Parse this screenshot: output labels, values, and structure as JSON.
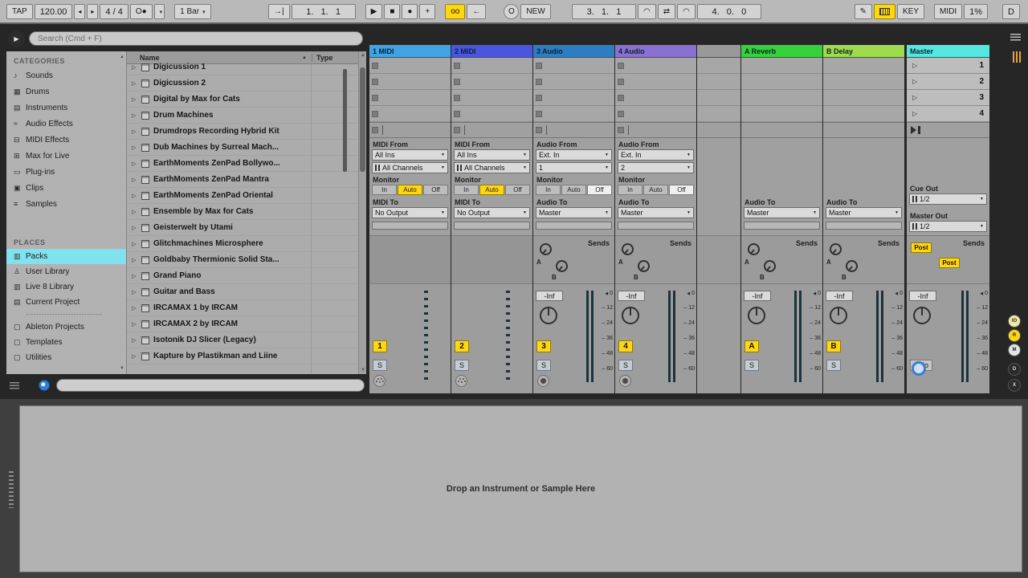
{
  "transport": {
    "tap": "TAP",
    "tempo": "120.00",
    "time_sig": "4 / 4",
    "quantize": "1 Bar",
    "position": "1.   1.   1",
    "new": "NEW",
    "loop_start": "3.   1.   1",
    "loop_length": "4.   0.   0",
    "key": "KEY",
    "midi": "MIDI",
    "cpu": "1%",
    "disk": "D"
  },
  "icons": {
    "preview_play": "▶",
    "nudge_down": "◂",
    "nudge_up": "▸",
    "metronome": "O●",
    "follow": "→|",
    "play": "▶",
    "stop": "■",
    "record": "●",
    "overdub": "+",
    "automation_arm": "oo",
    "reenable_automation": "←",
    "session_record": "O",
    "punch_in": "◠",
    "loop": "⇄",
    "punch_out": "◠",
    "draw": "✎",
    "expander": "▷",
    "sort_asc": "▲",
    "scroll_up": "▲",
    "scroll_down": "▼",
    "scene_play": "▷",
    "clip_zero": "◀"
  },
  "colors": {
    "track1": "#41a3e3",
    "track2": "#4b55dd",
    "track3": "#2e7cc1",
    "track4": "#8a70d0",
    "returnA": "#35d23c",
    "returnB": "#9edc4d",
    "master": "#55e6e0",
    "accent_yellow": "#ffd613",
    "selected_cyan": "#7fe2ee"
  },
  "browser": {
    "search_placeholder": "Search (Cmd + F)",
    "categories_title": "CATEGORIES",
    "categories": [
      {
        "icon": "♪",
        "label": "Sounds"
      },
      {
        "icon": "▦",
        "label": "Drums"
      },
      {
        "icon": "▤",
        "label": "Instruments"
      },
      {
        "icon": "≈",
        "label": "Audio Effects"
      },
      {
        "icon": "⊟",
        "label": "MIDI Effects"
      },
      {
        "icon": "⊞",
        "label": "Max for Live"
      },
      {
        "icon": "▭",
        "label": "Plug-ins"
      },
      {
        "icon": "▣",
        "label": "Clips"
      },
      {
        "icon": "≡",
        "label": "Samples"
      }
    ],
    "places_title": "PLACES",
    "places": [
      {
        "icon": "▥",
        "label": "Packs"
      },
      {
        "icon": "♙",
        "label": "User Library"
      },
      {
        "icon": "▥",
        "label": "Live 8 Library"
      },
      {
        "icon": "▤",
        "label": "Current Project"
      },
      {
        "icon": "",
        "label": "-----------------------------"
      },
      {
        "icon": "▢",
        "label": "Ableton Projects"
      },
      {
        "icon": "▢",
        "label": "Templates"
      },
      {
        "icon": "▢",
        "label": "Utilities"
      }
    ],
    "name_header": "Name",
    "type_header": "Type",
    "items": [
      "Digicussion 1",
      "Digicussion 2",
      "Digital by Max for Cats",
      "Drum Machines",
      "Drumdrops Recording Hybrid Kit",
      "Dub Machines by Surreal Mach...",
      "EarthMoments ZenPad Bollywo...",
      "EarthMoments ZenPad Mantra",
      "EarthMoments ZenPad Oriental",
      "Ensemble by Max for Cats",
      "Geisterwelt by Utami",
      "Glitchmachines Microsphere",
      "Goldbaby Thermionic Solid Sta...",
      "Grand Piano",
      "Guitar and Bass",
      "IRCAMAX 1 by IRCAM",
      "IRCAMAX 2 by IRCAM",
      "Isotonik DJ Slicer (Legacy)",
      "Kapture by Plastikman and Liine"
    ]
  },
  "session": {
    "scenes": [
      "1",
      "2",
      "3",
      "4"
    ],
    "zero": "0",
    "meter_scale": [
      "12",
      "24",
      "36",
      "48",
      "60"
    ],
    "sends_label": "Sends",
    "send_a": "A",
    "send_b": "B",
    "toggles": [
      {
        "label": "IO",
        "bg": "#efe9a8"
      },
      {
        "label": "R",
        "bg": "#ffd613"
      },
      {
        "label": "M",
        "bg": "#e4e4e4"
      },
      {
        "label": "D",
        "bg": "#2b2b2b"
      },
      {
        "label": "X",
        "bg": "#2b2b2b"
      }
    ],
    "tracks": {
      "t1": {
        "name": "1 MIDI",
        "in_label": "MIDI From",
        "in_value": "All Ins",
        "ch_value": "All Channels",
        "monitor_label": "Monitor",
        "mon_in": "In",
        "mon_auto": "Auto",
        "mon_off": "Off",
        "out_label": "MIDI To",
        "out_value": "No Output",
        "num": "1",
        "solo": "S"
      },
      "t2": {
        "name": "2 MIDI",
        "in_label": "MIDI From",
        "in_value": "All Ins",
        "ch_value": "All Channels",
        "monitor_label": "Monitor",
        "mon_in": "In",
        "mon_auto": "Auto",
        "mon_off": "Off",
        "out_label": "MIDI To",
        "out_value": "No Output",
        "num": "2",
        "solo": "S"
      },
      "t3": {
        "name": "3 Audio",
        "in_label": "Audio From",
        "in_value": "Ext. In",
        "ch_value": "1",
        "monitor_label": "Monitor",
        "mon_in": "In",
        "mon_auto": "Auto",
        "mon_off": "Off",
        "out_label": "Audio To",
        "out_value": "Master",
        "vol": "-Inf",
        "num": "3",
        "solo": "S"
      },
      "t4": {
        "name": "4 Audio",
        "in_label": "Audio From",
        "in_value": "Ext. In",
        "ch_value": "2",
        "monitor_label": "Monitor",
        "mon_in": "In",
        "mon_auto": "Auto",
        "mon_off": "Off",
        "out_label": "Audio To",
        "out_value": "Master",
        "vol": "-Inf",
        "num": "4",
        "solo": "S"
      },
      "ra": {
        "name": "A Reverb",
        "out_label": "Audio To",
        "out_value": "Master",
        "vol": "-Inf",
        "num": "A",
        "solo": "S"
      },
      "rb": {
        "name": "B Delay",
        "out_label": "Audio To",
        "out_value": "Master",
        "vol": "-Inf",
        "num": "B",
        "solo": "S"
      },
      "master": {
        "name": "Master",
        "cue_label": "Cue Out",
        "cue_value": "1/2",
        "mout_label": "Master Out",
        "mout_value": "1/2",
        "sends_label": "Sends",
        "post_a": "Post",
        "post_b": "Post",
        "vol": "-Inf",
        "solo": "Solo"
      }
    }
  },
  "detail": {
    "drop_hint": "Drop an Instrument or Sample Here"
  }
}
